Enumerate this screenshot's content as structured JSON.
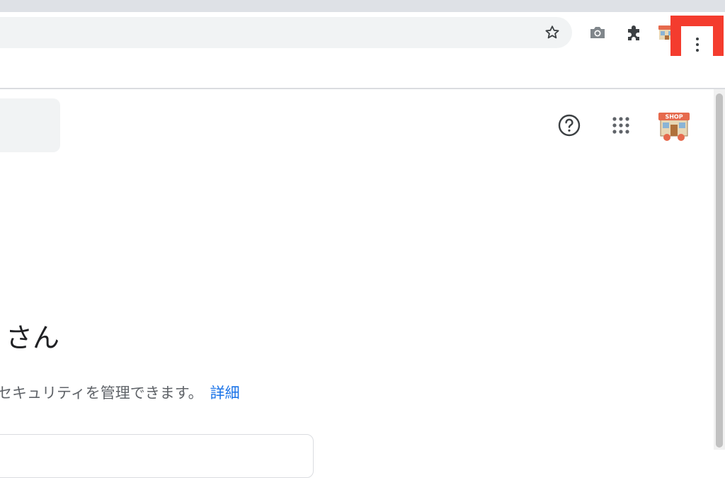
{
  "browser": {
    "toolbar": {
      "bookmark_icon": "star-outline-icon",
      "screenshot_icon": "camera-icon",
      "extensions_icon": "puzzle-icon",
      "profile_icon": "shop-avatar-icon",
      "menu_icon": "three-dots-vertical-icon",
      "highlight_color": "#f43c2e"
    }
  },
  "header": {
    "help_icon": "help-circle-icon",
    "apps_icon": "apps-grid-icon",
    "avatar_badge": "SHOP"
  },
  "main": {
    "greeting_suffix": "さん",
    "description": "セキュリティを管理できます。",
    "learn_more_link": "詳細"
  },
  "colors": {
    "link": "#1a73e8",
    "tabstrip": "#dee1e6",
    "omnibox": "#f1f3f4"
  }
}
